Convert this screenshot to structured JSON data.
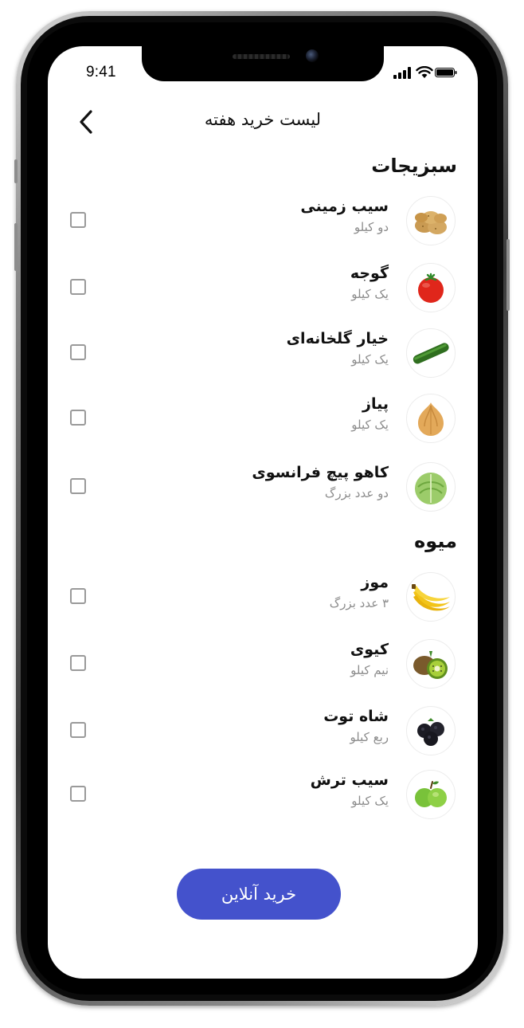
{
  "status_bar": {
    "time": "9:41"
  },
  "header": {
    "title": "لیست خرید هفته"
  },
  "sections": [
    {
      "title": "سبزیجات",
      "items": [
        {
          "name": "سیب زمینی",
          "quantity": "دو کیلو",
          "image": "potato-image"
        },
        {
          "name": "گوجه",
          "quantity": "یک کیلو",
          "image": "tomato-image"
        },
        {
          "name": "خیار گلخانه‌ای",
          "quantity": "یک کیلو",
          "image": "cucumber-image"
        },
        {
          "name": "پیاز",
          "quantity": "یک کیلو",
          "image": "onion-image"
        },
        {
          "name": "کاهو پیچ فرانسوی",
          "quantity": "دو عدد بزرگ",
          "image": "lettuce-image"
        }
      ]
    },
    {
      "title": "میوه",
      "items": [
        {
          "name": "موز",
          "quantity": "۳ عدد بزرگ",
          "image": "banana-image"
        },
        {
          "name": "کیوی",
          "quantity": "نیم کیلو",
          "image": "kiwi-image"
        },
        {
          "name": "شاه توت",
          "quantity": "ربع کیلو",
          "image": "blackberry-image"
        },
        {
          "name": "سیب ترش",
          "quantity": "یک کیلو",
          "image": "green-apple-image"
        }
      ]
    }
  ],
  "actions": {
    "buy_online_label": "خرید آنلاین"
  },
  "colors": {
    "accent": "#4452cc",
    "checkbox_border": "#9a9a9a",
    "secondary_text": "#8c8c8c"
  }
}
